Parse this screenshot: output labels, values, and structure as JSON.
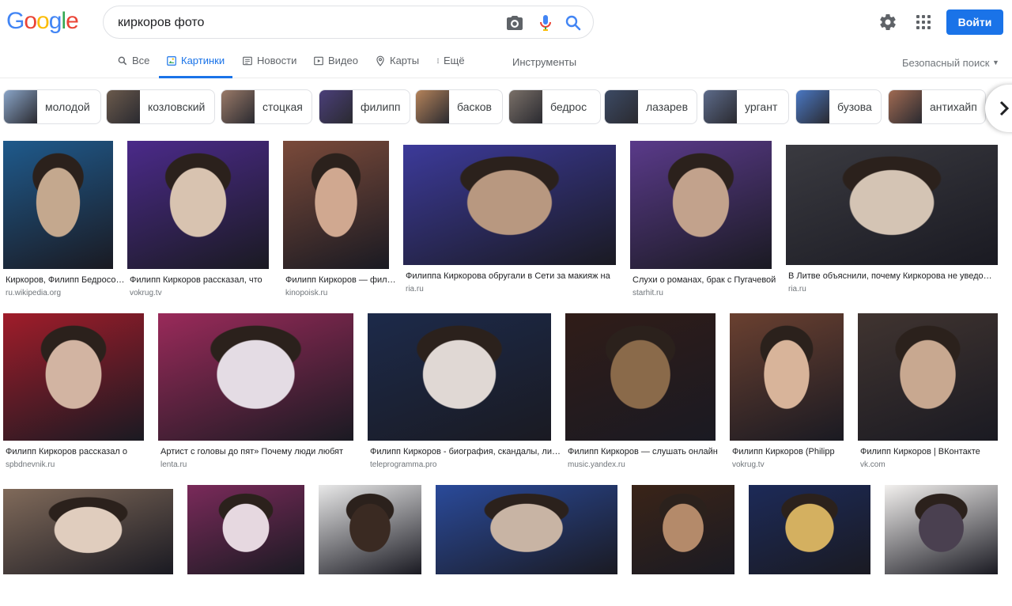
{
  "logo": {
    "letters": [
      "G",
      "o",
      "o",
      "g",
      "l",
      "e"
    ],
    "colors": [
      "#4285f4",
      "#ea4335",
      "#fbbc05",
      "#4285f4",
      "#34a853",
      "#ea4335"
    ]
  },
  "search": {
    "query": "киркоров фото"
  },
  "header": {
    "login": "Войти"
  },
  "tabs": [
    {
      "label": "Все",
      "icon": "search-icon",
      "active": false
    },
    {
      "label": "Картинки",
      "icon": "image-icon",
      "active": true
    },
    {
      "label": "Новости",
      "icon": "news-icon",
      "active": false
    },
    {
      "label": "Видео",
      "icon": "video-icon",
      "active": false
    },
    {
      "label": "Карты",
      "icon": "map-pin-icon",
      "active": false
    },
    {
      "label": "Ещё",
      "icon": "more-icon",
      "active": false
    }
  ],
  "tools": "Инструменты",
  "safesearch": "Безопасный поиск",
  "chips": [
    "молодой",
    "козловский",
    "стоцкая",
    "филипп",
    "басков",
    "бедрос",
    "лазарев",
    "ургант",
    "бузова",
    "антихайп"
  ],
  "results": [
    {
      "title": "Киркоров, Филипп Бедросович — Википедия",
      "source": "ru.wikipedia.org"
    },
    {
      "title": "Филипп Киркоров рассказал, что",
      "source": "vokrug.tv"
    },
    {
      "title": "Филипп Киркоров — фильмы",
      "source": "kinopoisk.ru"
    },
    {
      "title": "Филиппа Киркорова обругали в Сети за макияж на",
      "source": "ria.ru"
    },
    {
      "title": "Слухи о романах, брак с Пугачевой",
      "source": "starhit.ru"
    },
    {
      "title": "В Литве объяснили, почему Киркорова не уведомили",
      "source": "ria.ru"
    },
    {
      "title": "Филипп Киркоров рассказал о",
      "source": "spbdnevnik.ru"
    },
    {
      "title": "Артист с головы до пят» Почему люди любят",
      "source": "lenta.ru"
    },
    {
      "title": "Филипп Киркоров - биография, скандалы, личная",
      "source": "teleprogramma.pro"
    },
    {
      "title": "Филипп Киркоров — слушать онлайн",
      "source": "music.yandex.ru"
    },
    {
      "title": "Филипп Киркоров (Philipp",
      "source": "vokrug.tv"
    },
    {
      "title": "Филипп Киркоров | ВКонтакте",
      "source": "vk.com"
    },
    {
      "title": "",
      "source": ""
    },
    {
      "title": "",
      "source": ""
    },
    {
      "title": "",
      "source": ""
    },
    {
      "title": "",
      "source": ""
    },
    {
      "title": "",
      "source": ""
    },
    {
      "title": "",
      "source": ""
    },
    {
      "title": "",
      "source": ""
    }
  ],
  "colors": {
    "accent": "#1a73e8"
  }
}
